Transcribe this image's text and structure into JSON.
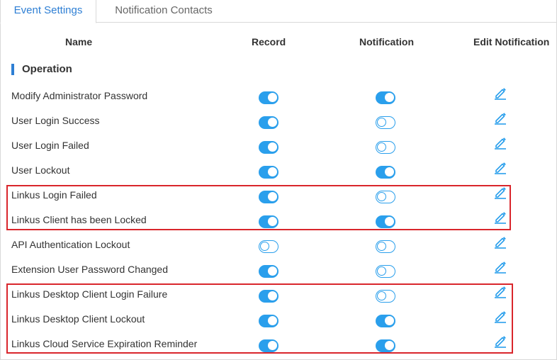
{
  "tabs": {
    "event_settings": "Event Settings",
    "notification_contacts": "Notification Contacts"
  },
  "columns": {
    "name": "Name",
    "record": "Record",
    "notification": "Notification",
    "edit": "Edit Notification"
  },
  "section": {
    "title": "Operation"
  },
  "colors": {
    "accent": "#2a9fec",
    "tab_active": "#2e7fd4",
    "highlight": "#d9262c"
  },
  "events": [
    {
      "name": "Modify Administrator Password",
      "record": true,
      "notification": true
    },
    {
      "name": "User Login Success",
      "record": true,
      "notification": false
    },
    {
      "name": "User Login Failed",
      "record": true,
      "notification": false
    },
    {
      "name": "User Lockout",
      "record": true,
      "notification": true
    },
    {
      "name": "Linkus Login Failed",
      "record": true,
      "notification": false
    },
    {
      "name": "Linkus Client has been Locked",
      "record": true,
      "notification": true
    },
    {
      "name": "API Authentication Lockout",
      "record": false,
      "notification": false
    },
    {
      "name": "Extension User Password Changed",
      "record": true,
      "notification": false
    },
    {
      "name": "Linkus Desktop Client Login Failure",
      "record": true,
      "notification": false
    },
    {
      "name": "Linkus Desktop Client Lockout",
      "record": true,
      "notification": true
    },
    {
      "name": "Linkus Cloud Service Expiration Reminder",
      "record": true,
      "notification": true
    }
  ]
}
